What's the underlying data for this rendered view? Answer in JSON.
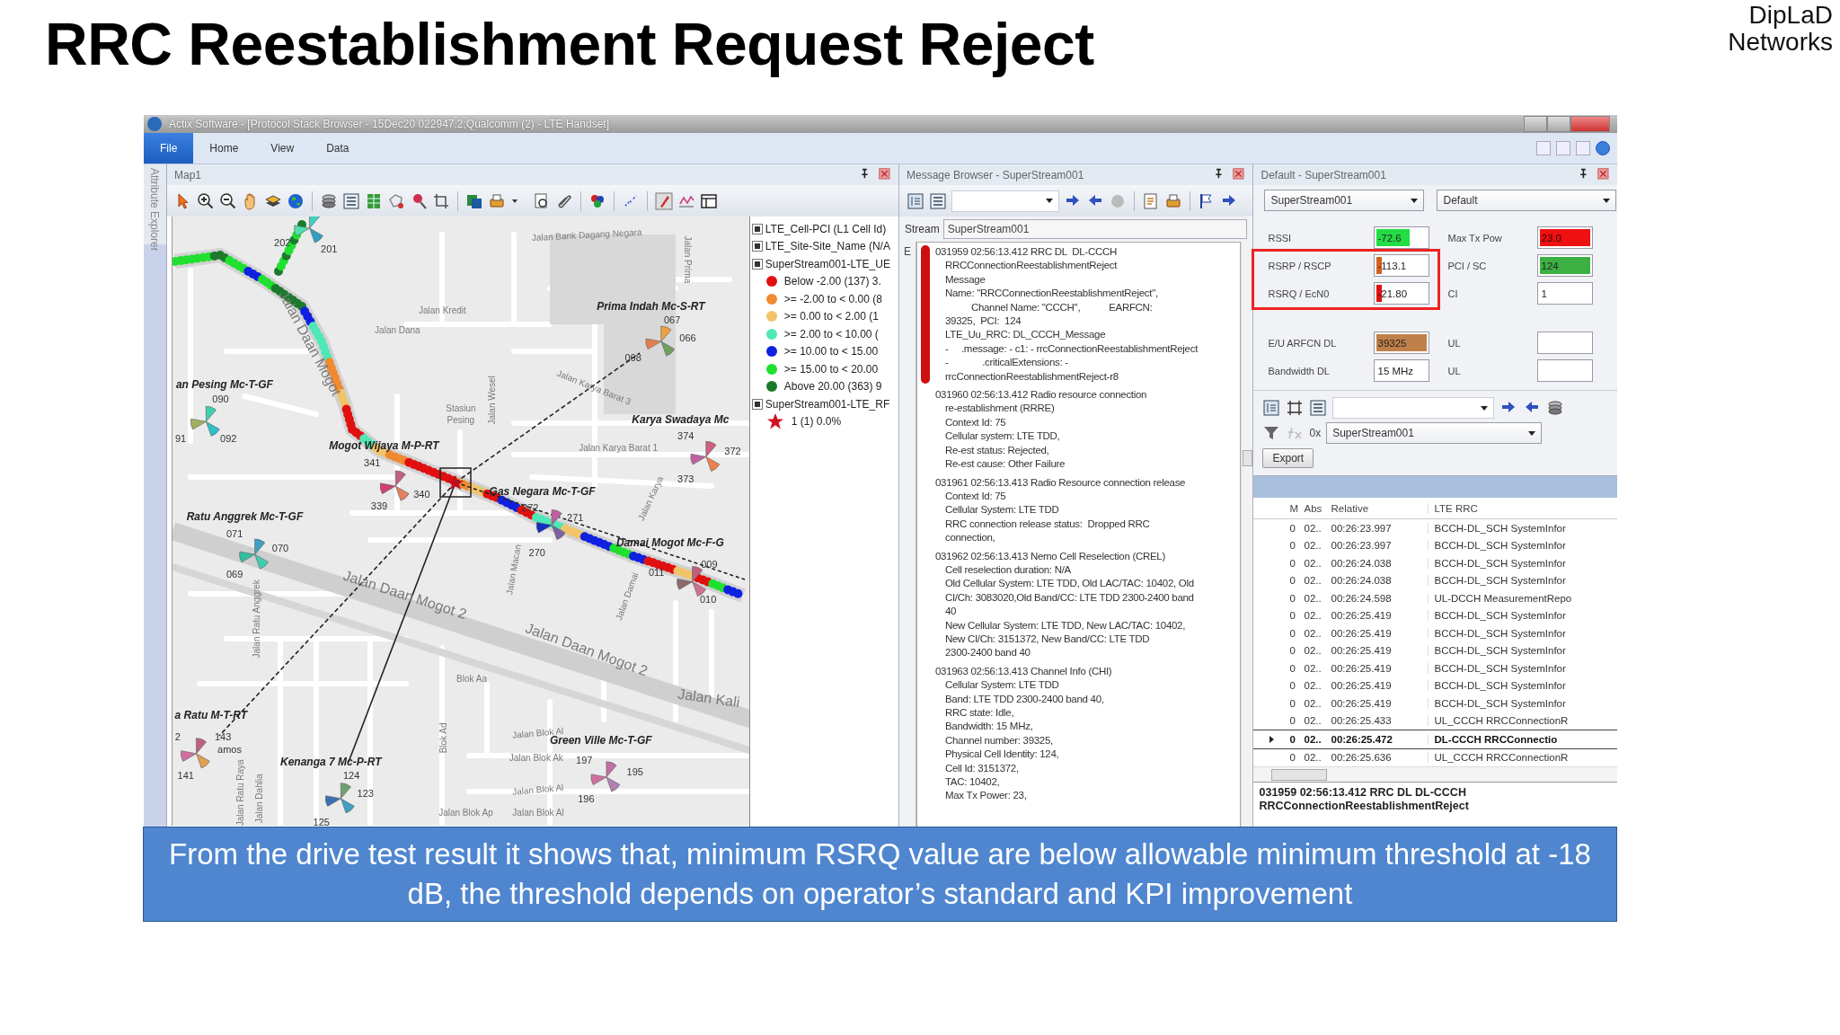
{
  "slide": {
    "title": "RRC Reestablishment Request Reject",
    "brand_lines": [
      "DipLaD",
      "Networks"
    ]
  },
  "window": {
    "title": "Actix Software - [Protocol Stack Browser  -  15Dec20 022947.2;Qualcomm (2) - LTE Handset]",
    "menu": [
      {
        "label": "File",
        "selected": true
      },
      {
        "label": "Home",
        "selected": false
      },
      {
        "label": "View",
        "selected": false
      },
      {
        "label": "Data",
        "selected": false
      }
    ],
    "side_tab": "Attribute Explorer"
  },
  "map_panel": {
    "title": "Map1",
    "sites": [
      "an Pesing Mc-T-GF",
      "Prima Indah Mc-S-RT",
      "Karya Swadaya Mc",
      "Mogot Wijaya M-P-RT",
      "Gas Negara Mc-T-GF",
      "Ratu Anggrek Mc-T-GF",
      "Damai Mogot Mc-F-G",
      "a Ratu M-T-RT",
      "Kenanga 7 Mc-P-RT",
      "Green Ville Mc-T-GF"
    ],
    "cells": [
      "202",
      "201",
      "090",
      "91",
      "092",
      "067",
      "066",
      "068",
      "374",
      "372",
      "373",
      "341",
      "340",
      "339",
      "272",
      "271",
      "270",
      "071",
      "070",
      "069",
      "009",
      "011",
      "010",
      "2",
      "143",
      "amos",
      "141",
      "124",
      "123",
      "125",
      "197",
      "195",
      "196"
    ],
    "streets": [
      "Jalan Bank Dagang Negara",
      "Jalan Prima",
      "Jalan Kredit",
      "Jalan Dana",
      "Jalan Daan Mogot",
      "Stasiun",
      "Pesing",
      "Jalan Wesel",
      "Jalan Karya Barat 3",
      "Jalan Karya Barat 1",
      "Jalan Karya",
      "Jalan Macan",
      "Jalan Damai",
      "Jalan Ratu Anggrek",
      "Jalan Daan Mogot 2",
      "Jalan Daan Mogot 2",
      "Jalan Kali",
      "Blok Aa",
      "Blok Ad",
      "Jalan Blok Al",
      "Jalan Blok Ak",
      "Jalan Blok Al",
      "Jalan Blok Ap",
      "Jalan Blok Al",
      "Jalan Ratu Raya",
      "Jalan Dahlia"
    ],
    "legend": [
      {
        "label": "LTE_Cell-PCI (L1 Cell Id)",
        "checked": true
      },
      {
        "label": "LTE_Site-Site_Name (N/A",
        "checked": true
      },
      {
        "label": "SuperStream001-LTE_UE",
        "checked": true,
        "children": [
          {
            "kind": "dot",
            "label": "Below -2.00 (137) 3.",
            "color": "#e01010"
          },
          {
            "kind": "dot",
            "label": ">= -2.00 to < 0.00 (8",
            "color": "#f08a30"
          },
          {
            "kind": "dot",
            "label": ">= 0.00 to < 2.00 (1",
            "color": "#f2c46a"
          },
          {
            "kind": "dot",
            "label": ">= 2.00 to < 10.00 (",
            "color": "#4ee8b8"
          },
          {
            "kind": "dot",
            "label": ">= 10.00 to < 15.00",
            "color": "#1020e0"
          },
          {
            "kind": "dot",
            "label": ">= 15.00 to < 20.00",
            "color": "#20e030"
          },
          {
            "kind": "dot",
            "label": "Above 20.00 (363) 9",
            "color": "#1c7a2c"
          }
        ]
      },
      {
        "label": "SuperStream001-LTE_RF",
        "checked": true,
        "children": [
          {
            "kind": "star",
            "label": "1 (1) 0.0%"
          }
        ]
      }
    ]
  },
  "message_browser": {
    "title": "Message Browser - SuperStream001",
    "stream_label": "Stream",
    "stream": "SuperStream001",
    "side_column": "E",
    "messages": [
      {
        "header": "031959 02:56:13.412 RRC DL  DL-CCCH",
        "selected": true,
        "lines": [
          "RRCConnectionReestablishmentReject",
          "Message",
          "Name: \"RRCConnectionReestablishmentReject\",",
          "          Channel Name: \"CCCH\",           EARFCN:",
          "39325,  PCI:  124",
          "LTE_Uu_RRC: DL_CCCH_Message",
          "-     .message: - c1: - rrcConnectionReestablishmentReject",
          "-             .criticalExtensions: -",
          "rrcConnectionReestablishmentReject-r8"
        ]
      },
      {
        "header": "031960 02:56:13.412 Radio resource connection",
        "selected": false,
        "lines": [
          "re-establishment (RRRE)",
          "Context Id: 75",
          "Cellular system: LTE TDD,",
          "Re-est status: Rejected,",
          "Re-est cause: Other Failure"
        ]
      },
      {
        "header": "031961 02:56:13.413 Radio Resource connection release",
        "selected": false,
        "lines": [
          "Context Id: 75",
          "Cellular System: LTE TDD",
          "RRC connection release status:  Dropped RRC",
          "connection,"
        ]
      },
      {
        "header": "031962 02:56:13.413 Nemo Cell Reselection (CREL)",
        "selected": false,
        "lines": [
          "Cell reselection duration: N/A",
          "Old Cellular System: LTE TDD, Old LAC/TAC: 10402, Old",
          "CI/Ch: 3083020,Old Band/CC: LTE TDD 2300-2400 band",
          "40",
          "New Cellular System: LTE TDD, New LAC/TAC: 10402,",
          "New CI/Ch: 3151372, New Band/CC: LTE TDD",
          "2300-2400 band 40"
        ]
      },
      {
        "header": "031963 02:56:13.413 Channel Info (CHI)",
        "selected": false,
        "lines": [
          "Cellular System: LTE TDD",
          "Band: LTE TDD 2300-2400 band 40,",
          "RRC state: Idle,",
          "Bandwidth: 15 MHz,",
          "Channel number: 39325,",
          "Physical Cell Identity: 124,",
          "Cell Id: 3151372,",
          "TAC: 10402,",
          "Max Tx Power: 23,"
        ]
      }
    ]
  },
  "stats_panel": {
    "title": "Default - SuperStream001",
    "stream_select": "SuperStream001",
    "view_select": "Default",
    "rows": [
      {
        "highlighted": false,
        "fields": [
          {
            "label": "RSSI",
            "value": "-72.6",
            "level": 0.65,
            "color": "#22dd44"
          },
          {
            "label": "Max Tx Pow",
            "value": "23.0",
            "level": 1,
            "color": "#ee1111"
          }
        ]
      },
      {
        "highlighted": true,
        "fields": [
          {
            "label": "RSRP / RSCP",
            "value": "-113.1",
            "level": 0.1,
            "color": "#d06020"
          },
          {
            "label": "PCI / SC",
            "value": "124",
            "level": 1,
            "color": "#3cb043"
          }
        ]
      },
      {
        "highlighted": true,
        "fields": [
          {
            "label": "RSRQ / EcN0",
            "value": "-21.80",
            "level": 0.1,
            "color": "#dd1111"
          },
          {
            "label": "CI",
            "value": "1",
            "level": 0,
            "color": "#ffffff"
          }
        ]
      },
      {
        "highlighted": false,
        "fields": [
          {
            "label": "E/U ARFCN DL",
            "value": "39325",
            "level": 1,
            "color": "#c0804a"
          },
          {
            "label": "UL",
            "level": 0,
            "color": "#ffffff"
          }
        ]
      },
      {
        "highlighted": false,
        "fields": [
          {
            "label": "Bandwidth DL",
            "value": "15 MHz",
            "level": 0,
            "color": "#ffffff"
          },
          {
            "label": "UL",
            "level": 0,
            "color": "#ffffff"
          }
        ]
      }
    ],
    "filter_select": "SuperStream001",
    "hex_toggle": "0x",
    "export": "Export",
    "table": {
      "columns": [
        "M",
        "Abs",
        "Relative",
        "LTE RRC"
      ],
      "rows": [
        {
          "selected": false,
          "cells": [
            "0",
            "02..",
            "00:26:23.997",
            "BCCH-DL_SCH  SystemInfor"
          ]
        },
        {
          "selected": false,
          "cells": [
            "0",
            "02..",
            "00:26:23.997",
            "BCCH-DL_SCH  SystemInfor"
          ]
        },
        {
          "selected": false,
          "cells": [
            "0",
            "02..",
            "00:26:24.038",
            "BCCH-DL_SCH  SystemInfor"
          ]
        },
        {
          "selected": false,
          "cells": [
            "0",
            "02..",
            "00:26:24.038",
            "BCCH-DL_SCH  SystemInfor"
          ]
        },
        {
          "selected": false,
          "cells": [
            "0",
            "02..",
            "00:26:24.598",
            "UL-DCCH MeasurementRepo"
          ]
        },
        {
          "selected": false,
          "cells": [
            "0",
            "02..",
            "00:26:25.419",
            "BCCH-DL_SCH  SystemInfor"
          ]
        },
        {
          "selected": false,
          "cells": [
            "0",
            "02..",
            "00:26:25.419",
            "BCCH-DL_SCH  SystemInfor"
          ]
        },
        {
          "selected": false,
          "cells": [
            "0",
            "02..",
            "00:26:25.419",
            "BCCH-DL_SCH  SystemInfor"
          ]
        },
        {
          "selected": false,
          "cells": [
            "0",
            "02..",
            "00:26:25.419",
            "BCCH-DL_SCH  SystemInfor"
          ]
        },
        {
          "selected": false,
          "cells": [
            "0",
            "02..",
            "00:26:25.419",
            "BCCH-DL_SCH  SystemInfor"
          ]
        },
        {
          "selected": false,
          "cells": [
            "0",
            "02..",
            "00:26:25.419",
            "BCCH-DL_SCH  SystemInfor"
          ]
        },
        {
          "selected": false,
          "cells": [
            "0",
            "02..",
            "00:26:25.433",
            "UL_CCCH  RRCConnectionR"
          ]
        },
        {
          "selected": true,
          "cells": [
            "0",
            "02..",
            "00:26:25.472",
            "DL-CCCH RRCConnectio"
          ]
        },
        {
          "selected": false,
          "cells": [
            "0",
            "02..",
            "00:26:25.636",
            "UL_CCCH  RRCConnectionR"
          ]
        }
      ]
    },
    "detail": [
      "031959 02:56:13.412 RRC DL  DL-CCCH",
      "RRCConnectionReestablishmentReject"
    ]
  },
  "caption": "From the drive test result it shows that, minimum RSRQ value are below allowable minimum threshold at -18 dB, the threshold depends on operator’s standard and KPI improvement"
}
